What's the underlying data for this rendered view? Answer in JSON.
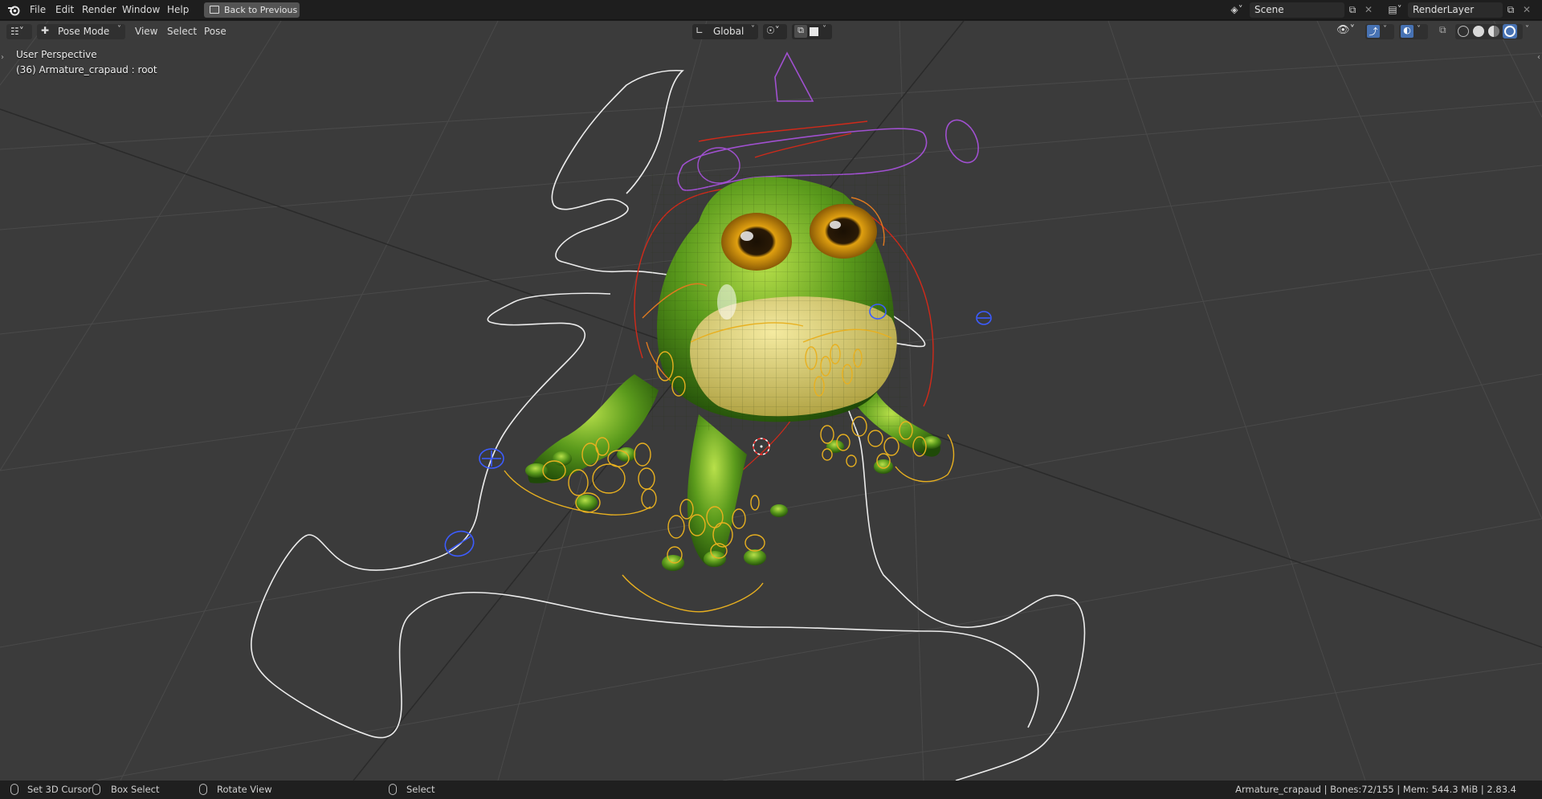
{
  "topbar": {
    "menus": [
      "File",
      "Edit",
      "Render",
      "Window",
      "Help"
    ],
    "back_button": "Back to Previous",
    "scene_name": "Scene",
    "view_layer_name": "RenderLayer"
  },
  "viewport_header": {
    "mode": "Pose Mode",
    "menus": [
      "View",
      "Select",
      "Pose"
    ],
    "transform_orientation": "Global"
  },
  "viewport": {
    "view_name": "User Perspective",
    "active_object": "(36) Armature_crapaud : root"
  },
  "statusbar": {
    "left_click": "Set 3D Cursor",
    "drag": "Box Select",
    "middle_click": "Rotate View",
    "right_click": "Select",
    "info": "Armature_crapaud | Bones:72/155 | Mem: 544.3 MiB | 2.83.4"
  },
  "icons": [
    "blender-logo-icon",
    "editor-type-icon",
    "pose-mode-icon",
    "orientation-icon",
    "pivot-icon",
    "snap-icon",
    "scene-icon",
    "view-layer-icon",
    "visibility-icon",
    "gizmo-icon",
    "overlay-icon",
    "xray-icon",
    "shading-wireframe-icon",
    "shading-solid-icon",
    "shading-material-icon",
    "shading-rendered-icon",
    "mouse-left-icon",
    "mouse-middle-icon",
    "mouse-right-icon"
  ],
  "colors": {
    "bone_custom_shape": "#e8b020",
    "root_control": "#ececec",
    "ik_controls": "#3c5cff",
    "head_control": "#a050d0",
    "spine_controls": "#d02a1a",
    "frog_skin": "#5fa820"
  }
}
